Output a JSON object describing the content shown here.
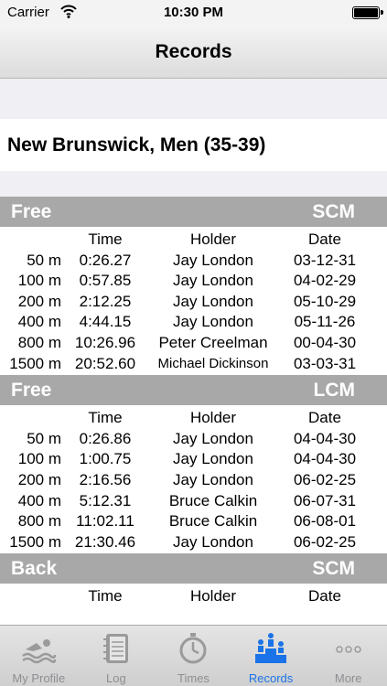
{
  "status_bar": {
    "carrier": "Carrier",
    "time": "10:30 PM"
  },
  "nav": {
    "title": "Records"
  },
  "location": "New Brunswick, Men (35-39)",
  "columns": {
    "time": "Time",
    "holder": "Holder",
    "date": "Date"
  },
  "sections": [
    {
      "stroke": "Free",
      "course": "SCM",
      "rows": [
        {
          "distance": "50 m",
          "time": "0:26.27",
          "holder": "Jay London",
          "date": "03-12-31"
        },
        {
          "distance": "100 m",
          "time": "0:57.85",
          "holder": "Jay London",
          "date": "04-02-29"
        },
        {
          "distance": "200 m",
          "time": "2:12.25",
          "holder": "Jay London",
          "date": "05-10-29"
        },
        {
          "distance": "400 m",
          "time": "4:44.15",
          "holder": "Jay London",
          "date": "05-11-26"
        },
        {
          "distance": "800 m",
          "time": "10:26.96",
          "holder": "Peter Creelman",
          "date": "00-04-30"
        },
        {
          "distance": "1500 m",
          "time": "20:52.60",
          "holder": "Michael Dickinson",
          "date": "03-03-31"
        }
      ]
    },
    {
      "stroke": "Free",
      "course": "LCM",
      "rows": [
        {
          "distance": "50 m",
          "time": "0:26.86",
          "holder": "Jay London",
          "date": "04-04-30"
        },
        {
          "distance": "100 m",
          "time": "1:00.75",
          "holder": "Jay London",
          "date": "04-04-30"
        },
        {
          "distance": "200 m",
          "time": "2:16.56",
          "holder": "Jay London",
          "date": "06-02-25"
        },
        {
          "distance": "400 m",
          "time": "5:12.31",
          "holder": "Bruce Calkin",
          "date": "06-07-31"
        },
        {
          "distance": "800 m",
          "time": "11:02.11",
          "holder": "Bruce Calkin",
          "date": "06-08-01"
        },
        {
          "distance": "1500 m",
          "time": "21:30.46",
          "holder": "Jay London",
          "date": "06-02-25"
        }
      ]
    },
    {
      "stroke": "Back",
      "course": "SCM",
      "rows": []
    }
  ],
  "tabs": [
    {
      "label": "My Profile",
      "icon": "swimmer-icon",
      "active": false
    },
    {
      "label": "Log",
      "icon": "notebook-icon",
      "active": false
    },
    {
      "label": "Times",
      "icon": "stopwatch-icon",
      "active": false
    },
    {
      "label": "Records",
      "icon": "podium-icon",
      "active": true
    },
    {
      "label": "More",
      "icon": "more-icon",
      "active": false
    }
  ],
  "colors": {
    "accent": "#1a73e8",
    "section_header": "#a8a8a8",
    "inactive_tab": "#8e8e93"
  }
}
